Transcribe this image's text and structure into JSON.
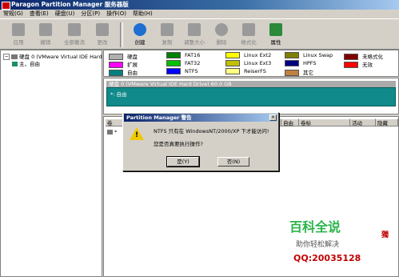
{
  "window": {
    "title": "Paragon Partition Manager 服务器版"
  },
  "menu": [
    "常规(G)",
    "查看(E)",
    "硬盘(U)",
    "分区(P)",
    "操作(O)",
    "帮助(H)"
  ],
  "toolbar": {
    "apply": "应用",
    "undo": "撤销",
    "undo_all": "全部撤消",
    "redo": "更改",
    "create": "创建",
    "copy": "复制",
    "resize": "调整大小",
    "delete": "删除",
    "format": "格式化",
    "properties": "属性"
  },
  "tree": {
    "disk": "硬盘 0 (VMware Virtual IDE Hard",
    "partition": "主，自由"
  },
  "legend": [
    {
      "label": "硬盘",
      "color": "#b0b0b0"
    },
    {
      "label": "FAT16",
      "color": "#008000"
    },
    {
      "label": "Linux Ext2",
      "color": "#ffff00"
    },
    {
      "label": "Linux Swap",
      "color": "#808000"
    },
    {
      "label": "未格式化",
      "color": "#800000"
    },
    {
      "label": "扩展",
      "color": "#ff00ff"
    },
    {
      "label": "FAT32",
      "color": "#00c000"
    },
    {
      "label": "Linux Ext3",
      "color": "#c0c000"
    },
    {
      "label": "HPFS",
      "color": "#000080"
    },
    {
      "label": "无效",
      "color": "#ff0000"
    },
    {
      "label": "自由",
      "color": "#008080"
    },
    {
      "label": "NTFS",
      "color": "#0000ff"
    },
    {
      "label": "ReiserFS",
      "color": "#ffff80"
    },
    {
      "label": "其它",
      "color": "#c08040"
    }
  ],
  "disk_panel": {
    "header": "硬盘 0 (VMware Virtual IDE Hard Drive) 60.0 GB",
    "partition_label": "*: 自由"
  },
  "table": {
    "columns": [
      "卷",
      "自由",
      "卷标",
      "活动",
      "隐藏"
    ],
    "row_label": "*"
  },
  "dialog": {
    "title": "Partition Manager 警告",
    "line1": "NTFS 只有在 WindowsNT/2000/XP 下才能访问!",
    "line2": "您是否真要执行操作?",
    "yes": "是(Y)",
    "no": "否(N)",
    "close": "×",
    "warn_glyph": "!"
  },
  "watermark": {
    "brand": "百科全说",
    "slogan": "助你轻松解决",
    "qq": "QQ:20035128",
    "seal": "獨"
  },
  "colors": {
    "free_partition": "#108a8a",
    "title_blue": "#0a246a"
  }
}
